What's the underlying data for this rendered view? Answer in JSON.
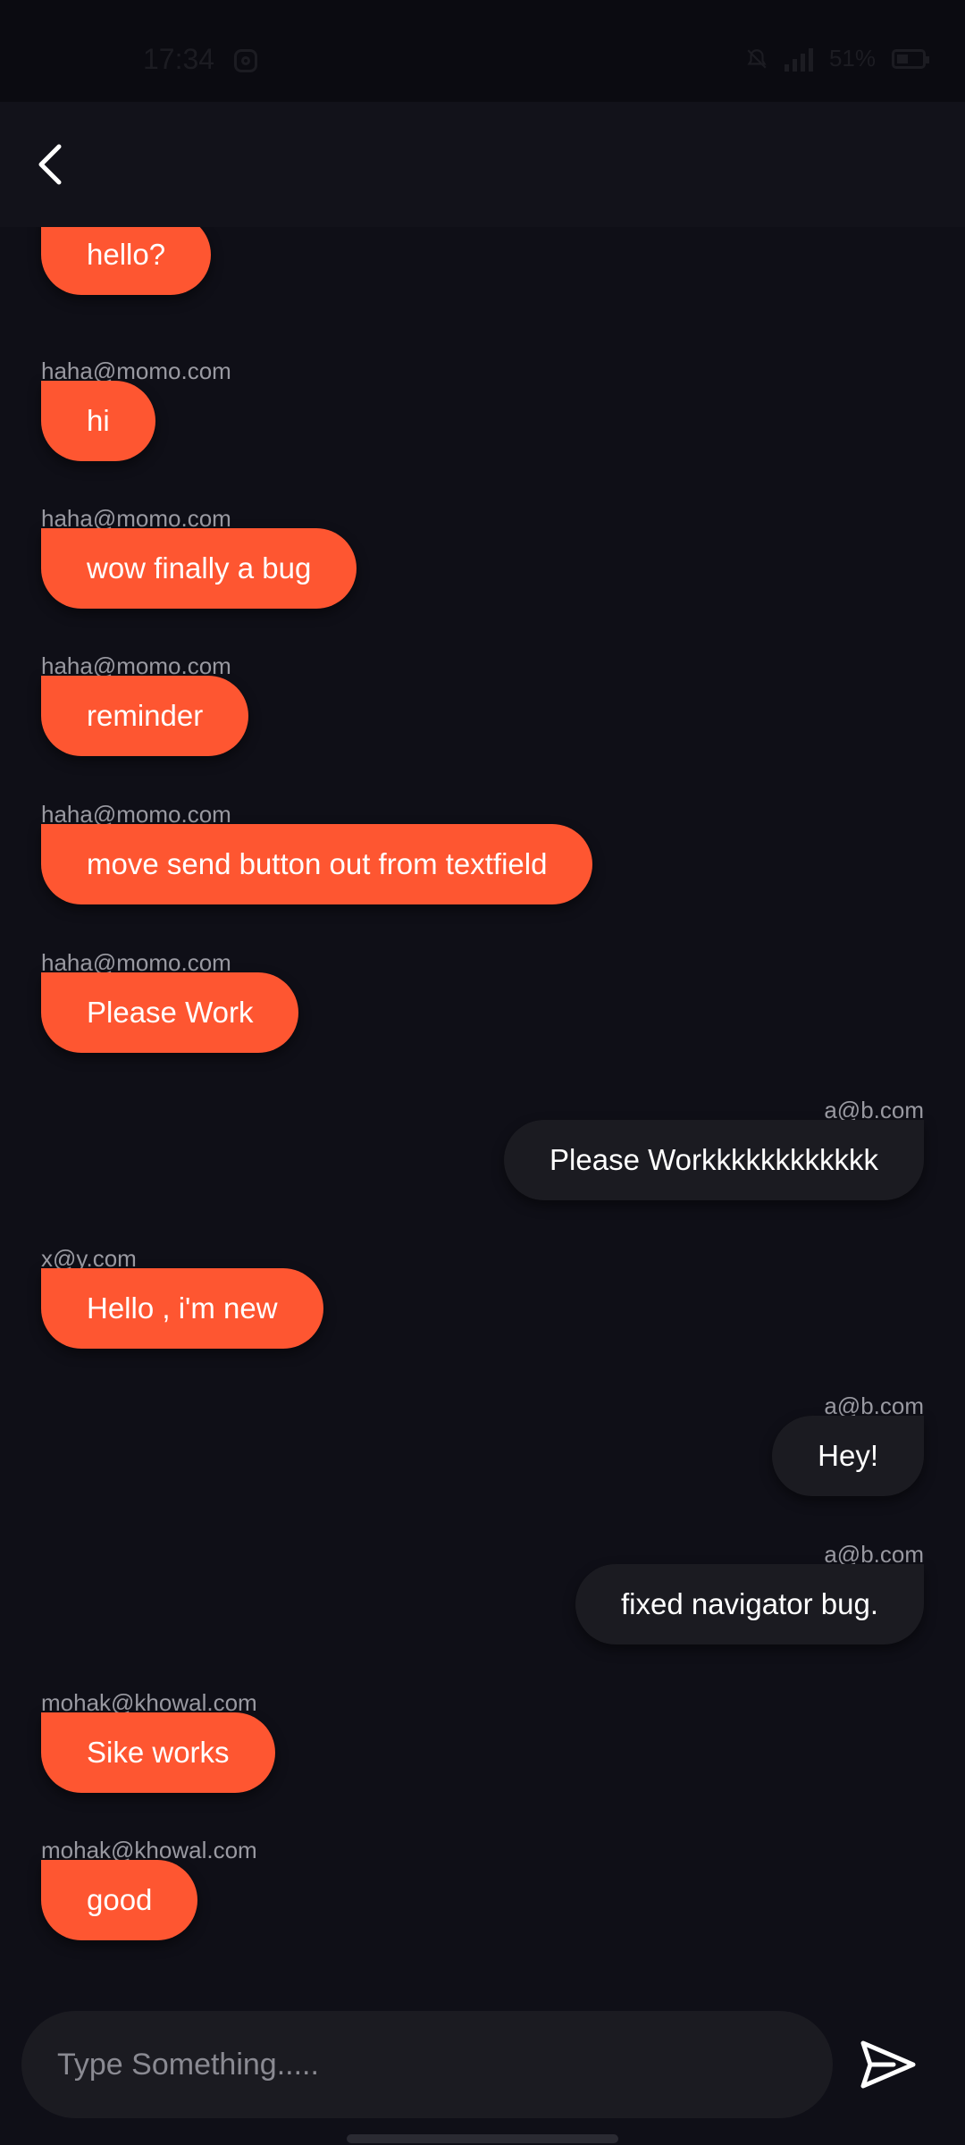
{
  "status_bar": {
    "time": "17:34",
    "battery": "51%"
  },
  "composer": {
    "placeholder": "Type Something....."
  },
  "messages": [
    {
      "sender": "",
      "text": "hello?",
      "side": "other"
    },
    {
      "sender": "haha@momo.com",
      "text": "hi",
      "side": "other"
    },
    {
      "sender": "haha@momo.com",
      "text": "wow finally a bug",
      "side": "other"
    },
    {
      "sender": "haha@momo.com",
      "text": "reminder",
      "side": "other"
    },
    {
      "sender": "haha@momo.com",
      "text": "move send button out from textfield",
      "side": "other"
    },
    {
      "sender": "haha@momo.com",
      "text": "Please Work",
      "side": "other"
    },
    {
      "sender": "a@b.com",
      "text": "Please Workkkkkkkkkkkk",
      "side": "mine"
    },
    {
      "sender": "x@y.com",
      "text": "Hello , i'm new",
      "side": "other"
    },
    {
      "sender": "a@b.com",
      "text": "Hey!",
      "side": "mine"
    },
    {
      "sender": "a@b.com",
      "text": "fixed navigator bug.",
      "side": "mine"
    },
    {
      "sender": "mohak@khowal.com",
      "text": "Sike works",
      "side": "other"
    },
    {
      "sender": "mohak@khowal.com",
      "text": "good",
      "side": "other"
    }
  ],
  "colors": {
    "background": "#0f0f17",
    "incoming_bubble": "#fe5631",
    "outgoing_bubble": "#1b1b21",
    "sender_text": "#9a9aa2"
  },
  "icons": {
    "back": "chevron-left-icon",
    "send": "send-icon"
  }
}
